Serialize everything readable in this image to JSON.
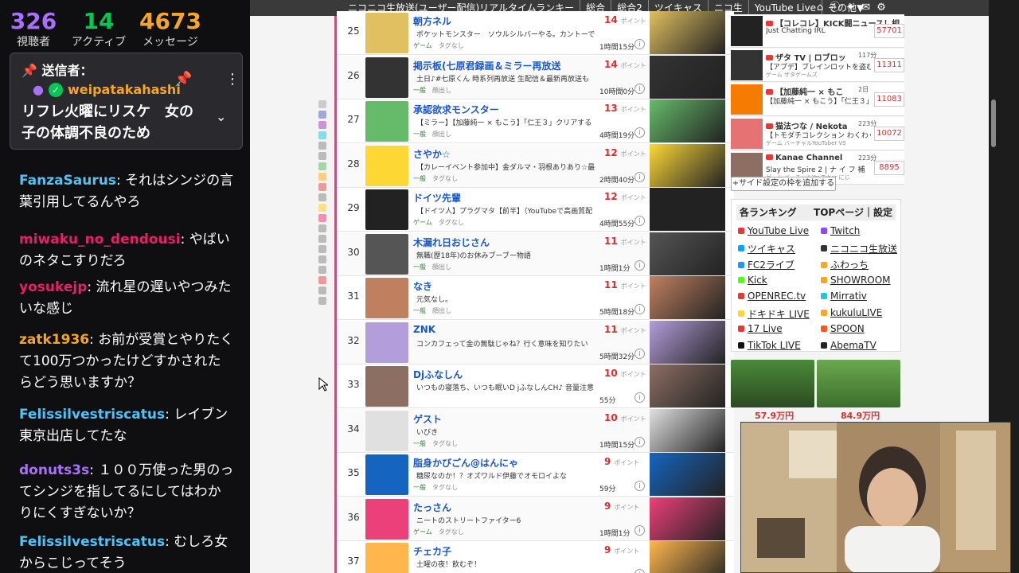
{
  "stats": [
    {
      "value": "326",
      "label": "視聴者",
      "color": "#a970ff"
    },
    {
      "value": "14",
      "label": "アクティブ",
      "color": "#00c853"
    },
    {
      "value": "4673",
      "label": "メッセージ",
      "color": "#f5a623"
    }
  ],
  "pinned": {
    "header": "送信者：",
    "user": "weipatakahashi",
    "message": "リフレ火曜にリスケ　女の子の体調不良のため",
    "trailing": "ため"
  },
  "chat": [
    {
      "name": "FanzaSaurus",
      "color": "#4fc3f7",
      "text": "それはシンジの言葉引用してるんやろ"
    },
    {
      "name": "miwaku_no_dendousi",
      "color": "#e91e63",
      "text": "やばいのネタこすりだろ"
    },
    {
      "name": "yosukejp",
      "color": "#e91e63",
      "text": "流れ星の遅いやつみたいな感じ"
    },
    {
      "name": "zatk1936",
      "color": "#f5a623",
      "text": "お前が受賞とやりたくて100万つかったけどすかされたらどう思いますか？"
    },
    {
      "name": "Felissilvestriscatus",
      "color": "#4fc3f7",
      "text": "レイブン東京出店してたな"
    },
    {
      "name": "donuts3s",
      "color": "#a970ff",
      "text": "１００万使った男のってシンジを指してるにしてはわかりにくすぎないか？"
    },
    {
      "name": "Felissilvestriscatus",
      "color": "#4fc3f7",
      "text": "むしろ女からこじってそう"
    }
  ],
  "topnav": {
    "items": [
      "ニコニコ生放送(ユーザー配信)リアルタイムランキー",
      "総合",
      "総合2",
      "ツイキャス",
      "ニコ生",
      "YouTube Live",
      "その他▼"
    ]
  },
  "ranking": [
    {
      "rank": "25",
      "title": "朝方ネル",
      "points": "14",
      "unit": "ポイント",
      "desc": "ポケットモンスター　ソウルシルバーやる。カントーで",
      "cat": "ゲーム",
      "tag": "タグなし",
      "time": "1時間15分",
      "color": "#e0c060"
    },
    {
      "rank": "26",
      "title": "掲示板(七原君録画＆ミラー再放送",
      "points": "14",
      "unit": "ポイント",
      "desc": "土日♪#七原くん 時系列再放送 生配信＆最新再放送も",
      "cat": "一般",
      "tag": "顔出し",
      "time": "10時間0分",
      "color": "#333"
    },
    {
      "rank": "27",
      "title": "承認欲求モンスター",
      "points": "13",
      "unit": "ポイント",
      "desc": "【ミラー】【加藤純一 × もこう】「仁王３」クリアする",
      "cat": "一般",
      "tag": "顔出し",
      "time": "4時間19分",
      "color": "#66bb6a"
    },
    {
      "rank": "28",
      "title": "さやか☆",
      "points": "12",
      "unit": "ポイント",
      "desc": "【カレーイベント参加中】金ダルマ・羽根ありあり☆最",
      "cat": "一般",
      "tag": "タグなし",
      "time": "2時間40分",
      "color": "#fdd835"
    },
    {
      "rank": "29",
      "title": "ドイツ先輩",
      "points": "12",
      "unit": "ポイント",
      "desc": "【ドイツ人】プラグマタ【前半】（YouTubeで高画質配",
      "cat": "ゲーム",
      "tag": "タグなし",
      "time": "4時間55分",
      "color": "#222"
    },
    {
      "rank": "30",
      "title": "木漏れ日おじさん",
      "points": "11",
      "unit": "ポイント",
      "desc": "無職(歴18年)のお休みブーブー物語",
      "cat": "一般",
      "tag": "顔出し",
      "time": "1時間1分",
      "color": "#555"
    },
    {
      "rank": "31",
      "title": "なき",
      "points": "11",
      "unit": "ポイント",
      "desc": "元気なし。",
      "cat": "一般",
      "tag": "顔出し",
      "time": "5時間18分",
      "color": "#c08060"
    },
    {
      "rank": "32",
      "title": "ZNK",
      "points": "11",
      "unit": "ポイント",
      "desc": "コンカフェって金の無駄じゃね？行く意味を知りたい",
      "cat": "",
      "tag": "",
      "time": "5時間32分",
      "color": "#b39ddb"
    },
    {
      "rank": "33",
      "title": "Djふなしん",
      "points": "10",
      "unit": "ポイント",
      "desc": "いつもの寝落ち、いつも眠いD jふなしんCH♪ 音量注意",
      "cat": "",
      "tag": "",
      "time": "55分",
      "color": "#8d6e63"
    },
    {
      "rank": "34",
      "title": "ゲスト",
      "points": "10",
      "unit": "ポイント",
      "desc": "いびき",
      "cat": "一般",
      "tag": "タグなし",
      "time": "1時間15分",
      "color": "#e0e0e0"
    },
    {
      "rank": "35",
      "title": "脂身かびごん@はんにゃ",
      "points": "9",
      "unit": "ポイント",
      "desc": "糖尿なのか！？オズワルド伊藤でオモロイよな",
      "cat": "一般",
      "tag": "タグなし",
      "time": "59分",
      "color": "#1565c0"
    },
    {
      "rank": "36",
      "title": "たっさん",
      "points": "9",
      "unit": "ポイント",
      "desc": "ニートのストリートファイター6",
      "cat": "ゲーム",
      "tag": "タグなし",
      "time": "1時間1分",
      "color": "#ec407a"
    },
    {
      "rank": "37",
      "title": "チェカ子",
      "points": "9",
      "unit": "ポイント",
      "desc": "土曜の夜！飲むぞ！",
      "cat": "",
      "tag": "",
      "time": "",
      "color": "#ffb74d"
    }
  ],
  "side_rows": [
    {
      "title": "【コレコレ】KICK闘ニュース！相",
      "desc": "Just Chatting IRL",
      "cat": "",
      "num": "57701",
      "dur": "",
      "color": "#222"
    },
    {
      "title": "ザタ TV | ロブロッ",
      "desc": "【アプデ】ブレインロットを盗むア",
      "cat": "ゲーム ザタゲームズ",
      "num": "11311",
      "dur": "117分",
      "color": "#333"
    },
    {
      "title": "【加藤純一 × もこ",
      "desc": "【加藤純一 × もこう】「仁王３」ク",
      "cat": "",
      "num": "11083",
      "dur": "2日",
      "color": "#f57c00"
    },
    {
      "title": "猫法つな / Nekota",
      "desc": "【トモダチコレクション わくわく生",
      "cat": "ゲーム バーチャルYouTuber VS",
      "num": "10072",
      "dur": "223分",
      "color": "#e57373"
    },
    {
      "title": "Kanae Channel",
      "desc": "Slay the Spire 2 | ナ イ フ 補",
      "cat": "ゲーム バーチャルYouTuber にじ",
      "num": "8895",
      "dur": "223分",
      "color": "#8d6e63"
    }
  ],
  "add_frame_label": "+サイド設定の枠を追加する",
  "rank_box": {
    "title": "各ランキング",
    "top_link": "TOPページ｜設定",
    "links": [
      {
        "label": "YouTube Live",
        "color": "#e53935"
      },
      {
        "label": "Twitch",
        "color": "#9146ff"
      },
      {
        "label": "ツイキャス",
        "color": "#03a9f4"
      },
      {
        "label": "ニコニコ生放送",
        "color": "#333"
      },
      {
        "label": "FC2ライブ",
        "color": "#2196f3"
      },
      {
        "label": "ふわっち",
        "color": "#f9a825"
      },
      {
        "label": "Kick",
        "color": "#53fc18"
      },
      {
        "label": "SHOWROOM",
        "color": "#f5a623"
      },
      {
        "label": "OPENREC.tv",
        "color": "#e53935"
      },
      {
        "label": "Mirrativ",
        "color": "#26c6da"
      },
      {
        "label": "ドキドキ LIVE",
        "color": "#fdd835"
      },
      {
        "label": "kukuluLIVE",
        "color": "#f9a825"
      },
      {
        "label": "17 Live",
        "color": "#e53935"
      },
      {
        "label": "SPOON",
        "color": "#ff5722"
      },
      {
        "label": "TikTok LIVE",
        "color": "#111"
      },
      {
        "label": "AbemaTV",
        "color": "#222"
      }
    ]
  },
  "ad": {
    "prices": [
      "57.9万円",
      "84.9万円"
    ]
  }
}
